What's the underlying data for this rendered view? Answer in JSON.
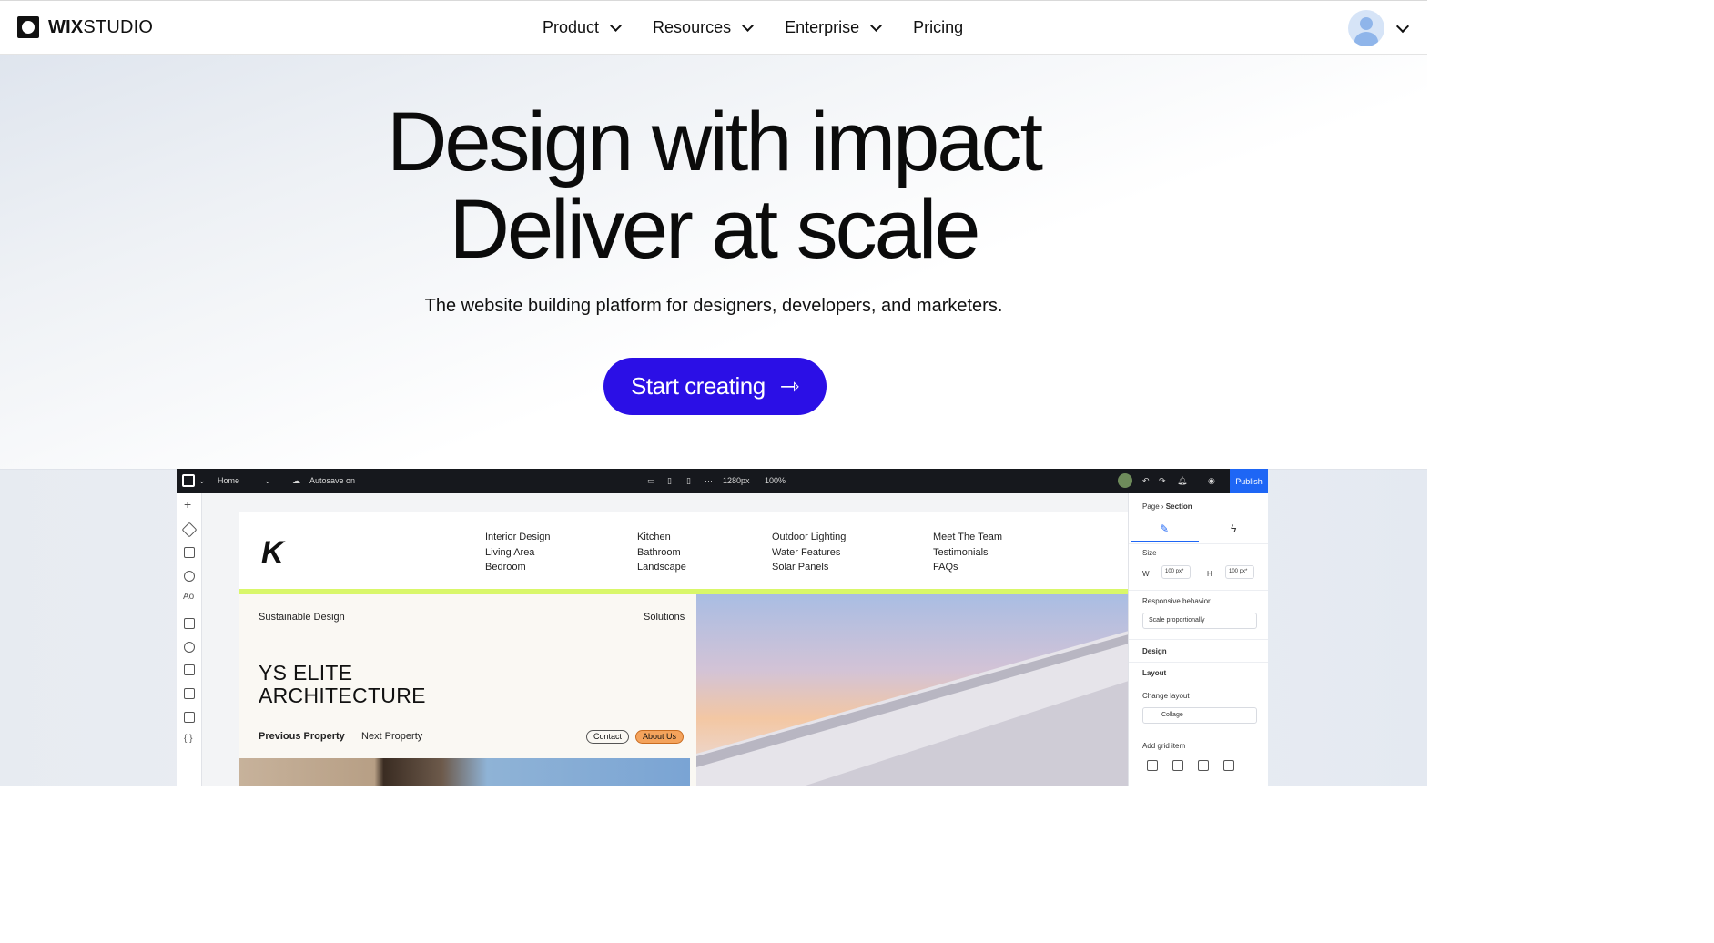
{
  "brand": {
    "bold": "WIX",
    "rest": "STUDIO"
  },
  "nav": {
    "items": [
      {
        "label": "Product",
        "has_dropdown": true
      },
      {
        "label": "Resources",
        "has_dropdown": true
      },
      {
        "label": "Enterprise",
        "has_dropdown": true
      },
      {
        "label": "Pricing",
        "has_dropdown": false
      }
    ]
  },
  "hero": {
    "title_line1": "Design with impact",
    "title_line2": "Deliver at scale",
    "subtitle": "The website building platform for designers, developers, and marketers.",
    "cta_label": "Start creating",
    "cta_color": "#2b0fe6"
  },
  "editor": {
    "page_select": "Home",
    "autosave": "Autosave on",
    "breakpoint": "1280px",
    "zoom": "100%",
    "publish_label": "Publish",
    "panel": {
      "breadcrumb_page": "Page",
      "breadcrumb_section": "Section",
      "size_label": "Size",
      "width_label": "W",
      "width_value": "100 px*",
      "height_label": "H",
      "height_value": "100 px*",
      "responsive_label": "Responsive behavior",
      "responsive_value": "Scale proportionally",
      "design_label": "Design",
      "layout_label": "Layout",
      "change_layout_label": "Change layout",
      "change_layout_value": "Collage",
      "add_grid_label": "Add grid item"
    }
  },
  "site": {
    "menu_cols": [
      [
        "Interior Design",
        "Living Area",
        "Bedroom"
      ],
      [
        "Kitchen",
        "Bathroom",
        "Landscape"
      ],
      [
        "Outdoor Lighting",
        "Water Features",
        "Solar Panels"
      ],
      [
        "Meet The Team",
        "Testimonials",
        "FAQs"
      ]
    ],
    "eyebrow": "Sustainable Design",
    "solutions": "Solutions",
    "heading_line1": "YS ELITE",
    "heading_line2": "ARCHITECTURE",
    "prev": "Previous Property",
    "next": "Next Property",
    "contact": "Contact",
    "about": "About Us",
    "stripe_color": "#d9f76a"
  }
}
